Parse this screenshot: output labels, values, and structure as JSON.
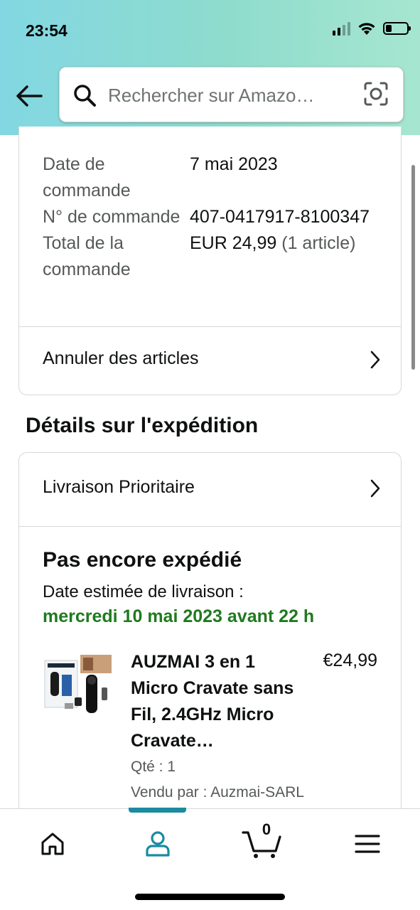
{
  "status_bar": {
    "time": "23:54"
  },
  "search": {
    "placeholder": "Rechercher sur Amazo…"
  },
  "order_info": {
    "rows": [
      {
        "label": "Date de commande",
        "value": "7 mai 2023",
        "extra": ""
      },
      {
        "label": "N° de commande",
        "value": "407-0417917-8100347",
        "extra": ""
      },
      {
        "label": "Total de la commande",
        "value": "EUR 24,99",
        "extra": " (1 article)"
      }
    ],
    "cancel_link": "Annuler des articles"
  },
  "shipping": {
    "section_title": "Détails sur l'expédition",
    "method": "Livraison Prioritaire",
    "status": "Pas encore expédié",
    "estimate_label": "Date estimée de livraison :",
    "estimate_date": "mercredi 10 mai 2023 avant 22 h"
  },
  "product": {
    "title": "AUZMAI 3 en 1 Micro Cravate sans Fil, 2.4GHz Micro Cravate…",
    "price": "€24,99",
    "quantity": "Qté : 1",
    "seller": "Vendu par : Auzmai-SARL"
  },
  "tabbar": {
    "cart_count": "0",
    "active_tab": "profile"
  },
  "colors": {
    "header_gradient_start": "#82d7e2",
    "header_gradient_end": "#a6e6d0",
    "delivery_green": "#1f7a1f",
    "active_tab": "#1a8ba0"
  }
}
